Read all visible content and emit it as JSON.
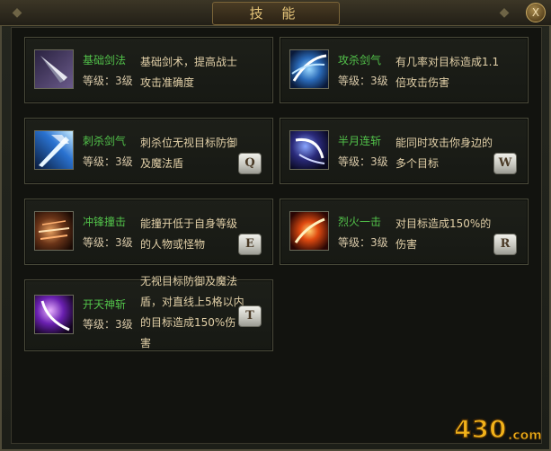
{
  "window": {
    "title": "技 能",
    "close_label": "X"
  },
  "skills": [
    {
      "name": "基础剑法",
      "level": "等级：3级",
      "desc": "基础剑术，提高战士攻击准确度",
      "hotkey": "",
      "icon": "sword-tip-icon"
    },
    {
      "name": "攻杀剑气",
      "level": "等级：3级",
      "desc": "有几率对目标造成1.1倍攻击伤害",
      "hotkey": "",
      "icon": "blue-slash-icon"
    },
    {
      "name": "刺杀剑气",
      "level": "等级：3级",
      "desc": "刺杀位无视目标防御及魔法盾",
      "hotkey": "Q",
      "icon": "thrust-icon"
    },
    {
      "name": "半月连斩",
      "level": "等级：3级",
      "desc": "能同时攻击你身边的多个目标",
      "hotkey": "W",
      "icon": "half-moon-icon"
    },
    {
      "name": "冲锋撞击",
      "level": "等级：3级",
      "desc": "能撞开低于自身等级的人物或怪物",
      "hotkey": "E",
      "icon": "charge-icon"
    },
    {
      "name": "烈火一击",
      "level": "等级：3级",
      "desc": "对目标造成150%的伤害",
      "hotkey": "R",
      "icon": "fire-strike-icon"
    },
    {
      "name": "开天神斩",
      "level": "等级：3级",
      "desc": "无视目标防御及魔法盾，对直线上5格以内的目标造成150%伤害",
      "hotkey": "T",
      "icon": "purple-slash-icon"
    }
  ],
  "watermark": "430.com"
}
